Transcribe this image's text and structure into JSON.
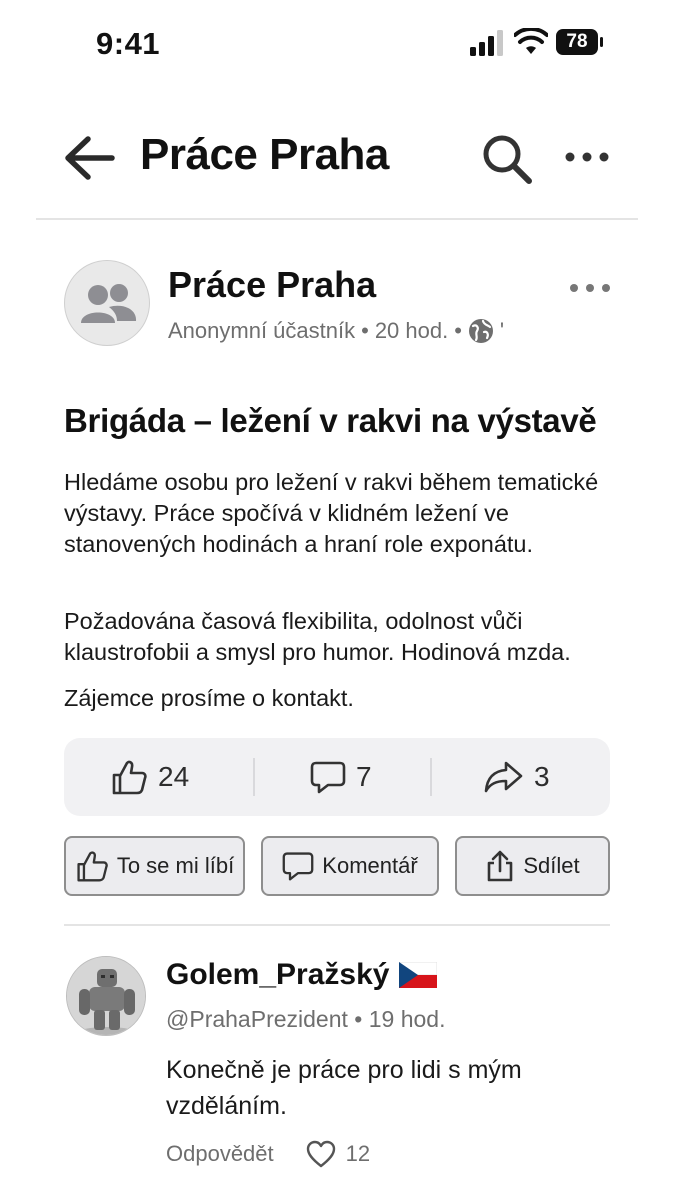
{
  "status_bar": {
    "time": "9:41",
    "battery": "78"
  },
  "nav": {
    "title": "Práce Praha"
  },
  "post": {
    "group_name": "Práce Praha",
    "author": "Anonymní účastník",
    "time": "20 hod.",
    "headline": "Brigáda – ležení v rakvi na výstavě",
    "paragraphs": [
      "Hledáme osobu pro ležení v rakvi během tematické výstavy. Práce spočívá v klidném ležení ve stanovených hodinách a hraní role exponátu.",
      "Požadována časová flexibilita, odolnost vůči klaustrofobii a smysl pro humor. Hodinová mzda.",
      "Zájemce prosíme o kontakt."
    ],
    "stats": {
      "likes": "24",
      "comments": "7",
      "shares": "3"
    },
    "actions": {
      "like": "To se mi líbí",
      "comment": "Komentář",
      "share": "Sdílet"
    }
  },
  "comment": {
    "name": "Golem_Pražský",
    "handle": "@PrahaPrezident",
    "time": "19 hod.",
    "text": "Konečně je práce pro lidi s mým vzděláním.",
    "reply": "Odpovědět",
    "likes": "12"
  },
  "colors": {
    "text": "#111111",
    "muted": "#6e6e6e",
    "stats_bg": "#f1f1f3",
    "button_bg": "#ececef"
  }
}
